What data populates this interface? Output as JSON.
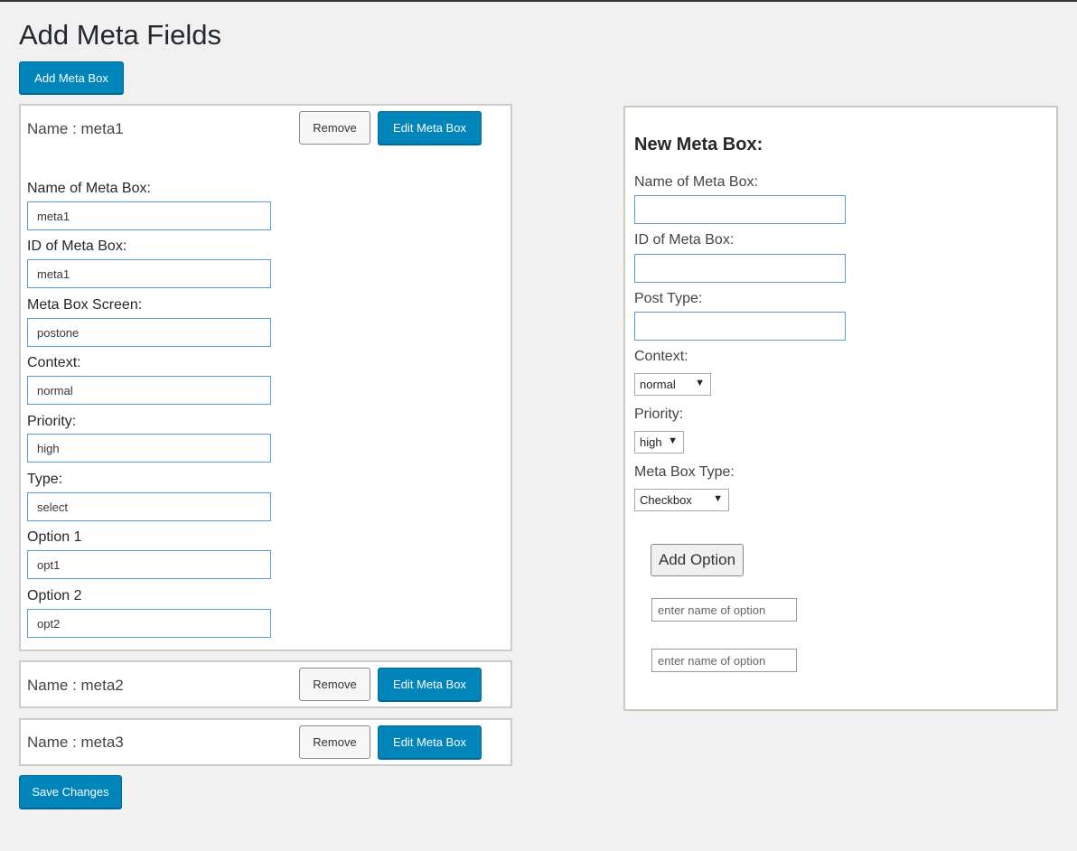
{
  "page": {
    "title": "Add Meta Fields",
    "add_meta_box_label": "Add Meta Box",
    "save_changes_label": "Save Changes"
  },
  "meta_boxes": [
    {
      "name": "Name : meta1",
      "remove_label": "Remove",
      "edit_label": "Edit Meta Box",
      "fields": [
        {
          "label": "Name of Meta Box:",
          "value": "meta1"
        },
        {
          "label": "ID of Meta Box:",
          "value": "meta1"
        },
        {
          "label": "Meta Box Screen:",
          "value": "postone"
        },
        {
          "label": "Context:",
          "value": "normal"
        },
        {
          "label": "Priority:",
          "value": "high"
        },
        {
          "label": "Type:",
          "value": "select"
        },
        {
          "label": "Option 1",
          "value": "opt1"
        },
        {
          "label": "Option 2",
          "value": "opt2"
        }
      ]
    },
    {
      "name": "Name : meta2",
      "remove_label": "Remove",
      "edit_label": "Edit Meta Box"
    },
    {
      "name": "Name : meta3",
      "remove_label": "Remove",
      "edit_label": "Edit Meta Box"
    }
  ],
  "new_meta_box": {
    "title": "New Meta Box:",
    "name_label": "Name of Meta Box:",
    "id_label": "ID of Meta Box:",
    "post_type_label": "Post Type:",
    "context_label": "Context:",
    "context_value": "normal",
    "priority_label": "Priority:",
    "priority_value": "high",
    "type_label": "Meta Box Type:",
    "type_value": "Checkbox",
    "add_option_label": "Add Option",
    "option_placeholder": "enter name of option"
  },
  "colors": {
    "primary": "#0085ba",
    "background": "#f1f1f1"
  }
}
